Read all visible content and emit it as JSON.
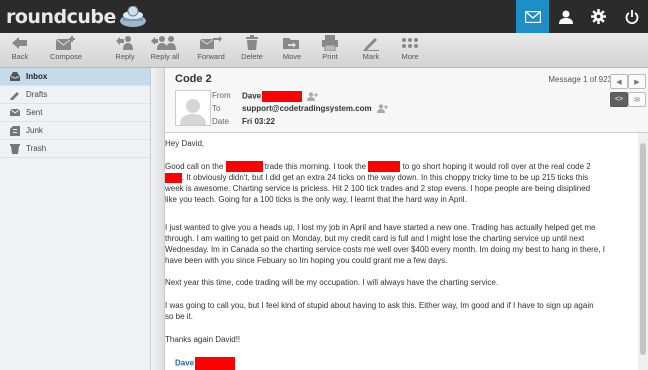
{
  "app": {
    "logo_text": "roundcube"
  },
  "toolbar": {
    "back": "Back",
    "compose": "Compose",
    "reply": "Reply",
    "reply_all": "Reply all",
    "forward": "Forward",
    "delete": "Delete",
    "move": "Move",
    "print": "Print",
    "mark": "Mark",
    "more": "More"
  },
  "folders": [
    {
      "label": "Inbox",
      "icon": "inbox-icon",
      "selected": true
    },
    {
      "label": "Drafts",
      "icon": "pencil-icon"
    },
    {
      "label": "Sent",
      "icon": "sent-icon"
    },
    {
      "label": "Junk",
      "icon": "junk-icon"
    },
    {
      "label": "Trash",
      "icon": "trash-icon"
    }
  ],
  "message": {
    "subject": "Code 2",
    "count": "Message 1 of 923",
    "from_label": "From",
    "from_name": "Dave",
    "to_label": "To",
    "to_value": "support@codetradingsystem.com",
    "date_label": "Date",
    "date_value": "Fri 03:22",
    "body": {
      "greeting": "Hey David,",
      "p1a": "Good call on the",
      "p1b": "trade this morning.  I took the",
      "p1c": "to go short hoping it would roll over at the real code 2",
      "p1d": ".  It obviously didn't, but I did get an extra 24 ticks on the way down.  In this choppy tricky time to be up 215 ticks this",
      "p1e": "week is awesome.  Charting service is pricless. Hit 2 100 tick trades and 2 stop evens.  I hope people are being disiplined",
      "p1f": "like you teach.  Going for a 100 ticks is the only way, I learnt that the hard way in April.",
      "p2a": "I just wanted to give you a heads up, I lost my job in April and have started a new one.  Trading has actually helped get me",
      "p2b": "through.  I am waiting to get paid on Monday, but my credit card is full and I might lose the charting service up until next",
      "p2c": "Wednesday. Im in Canada so the charting service costs me well over $400 every month.  Im doing my best to hang in there, I",
      "p2d": "have been with you since Febuary so Im hoping you could grant me a few days.",
      "p3": "Next year this time, code trading will be my occupation.  I will always have the charting service.",
      "p4a": "I was going to call you, but I feel kind of stupid  about having to ask this.  Either way, Im good and if I have to sign up again",
      "p4b": "so be it.",
      "p5": "Thanks again David!!",
      "signature": "Dave"
    }
  },
  "colors": {
    "topbar": "#2b2b2b",
    "active": "#1d8fc6",
    "redaction": "#ff0000",
    "link": "#1f6bb5"
  }
}
